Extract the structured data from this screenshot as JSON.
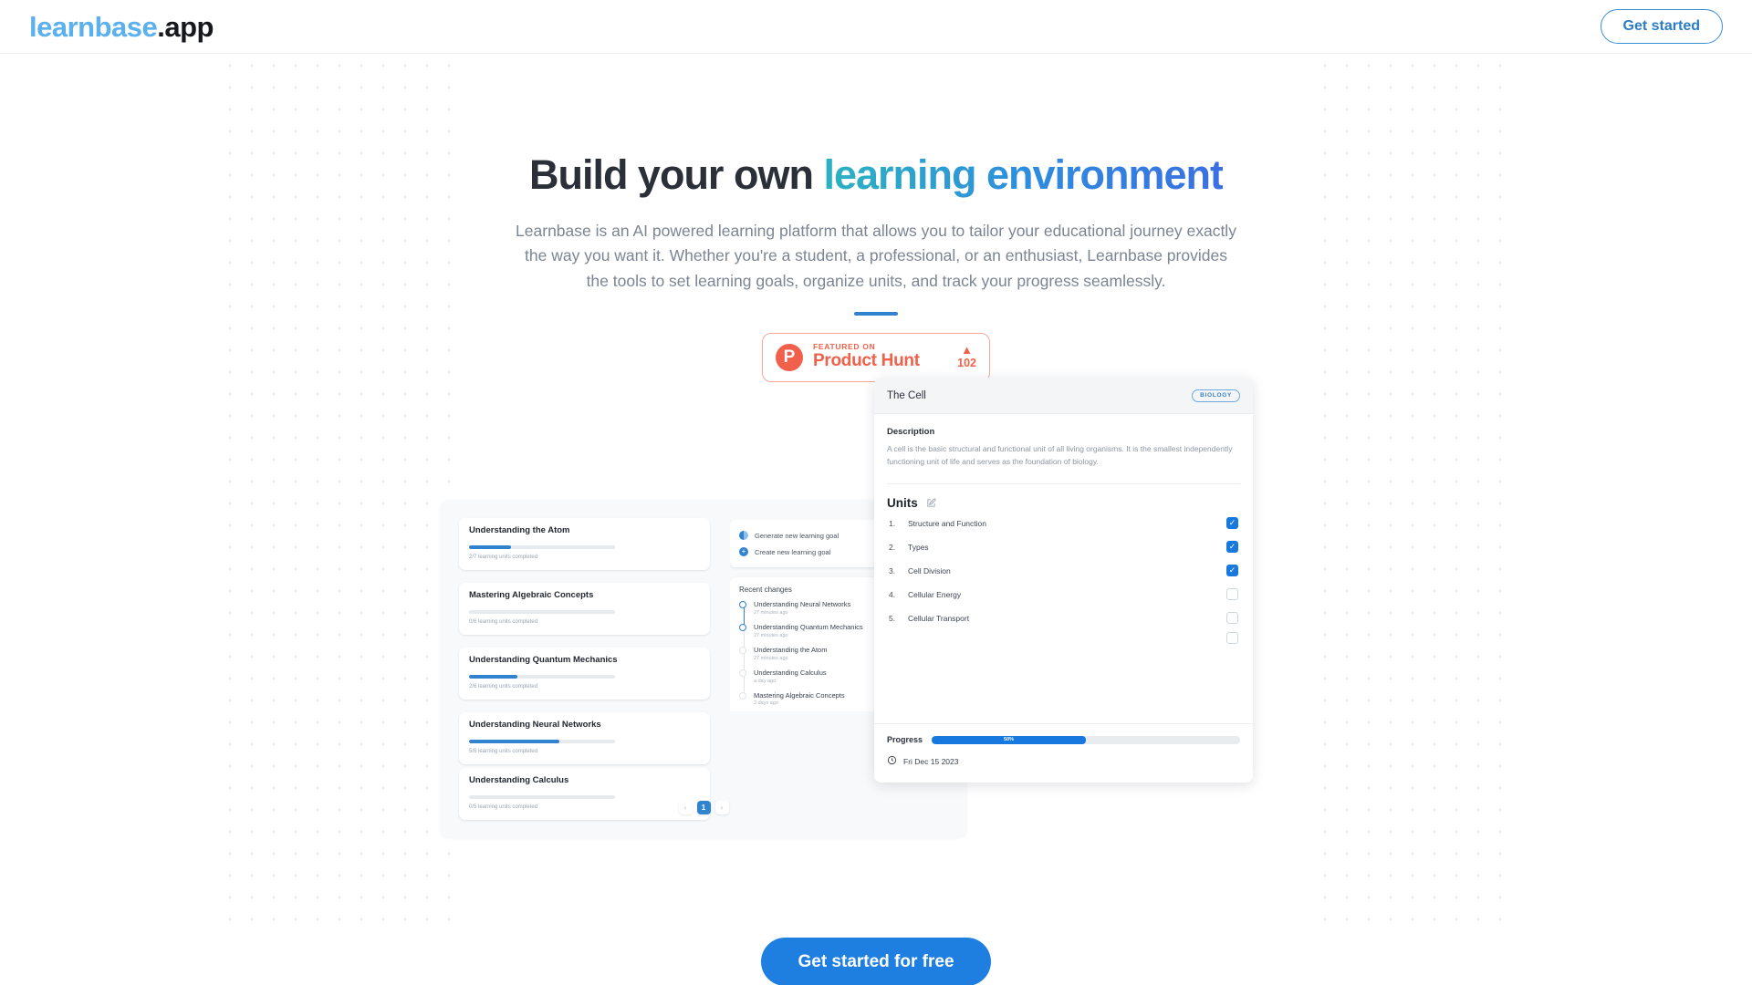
{
  "header": {
    "logo_brand": "learnbase",
    "logo_tld": ".app",
    "cta_label": "Get started"
  },
  "hero": {
    "headline_plain": "Build your own ",
    "headline_accent": "learning environment",
    "subtitle": "Learnbase is an AI powered learning platform that allows you to tailor your educational journey exactly the way you want it. Whether you're a student, a professional, or an enthusiast, Learnbase provides the tools to set learning goals, organize units, and track your progress seamlessly.",
    "product_hunt": {
      "logo_letter": "P",
      "kicker": "FEATURED ON",
      "name": "Product Hunt",
      "caret": "▲",
      "count": "102"
    }
  },
  "mockup": {
    "goals_panel": {
      "cards": [
        {
          "title": "Understanding the Atom",
          "progress_pct": 29,
          "sub": "2/7 learning units completed"
        },
        {
          "title": "Mastering Algebraic Concepts",
          "progress_pct": 0,
          "sub": "0/6 learning units completed"
        },
        {
          "title": "Understanding Quantum Mechanics",
          "progress_pct": 33,
          "sub": "2/6 learning units completed"
        },
        {
          "title": "Understanding Neural Networks",
          "progress_pct": 62,
          "sub": "5/8 learning units completed"
        },
        {
          "title": "Understanding Calculus",
          "progress_pct": 0,
          "sub": "0/5 learning units completed"
        }
      ],
      "pagination": {
        "prev": "‹",
        "current": "1",
        "next": "›"
      }
    },
    "actions_panel": {
      "actions": [
        {
          "label": "Generate new learning goal",
          "icon": "sparkle-icon"
        },
        {
          "label": "Create new learning goal",
          "icon": "plus-icon"
        }
      ],
      "recent_title": "Recent changes",
      "recent": [
        {
          "name": "Understanding Neural Networks",
          "time": "27 minutes ago",
          "active": true
        },
        {
          "name": "Understanding Quantum Mechanics",
          "time": "27 minutes ago",
          "active": true
        },
        {
          "name": "Understanding the Atom",
          "time": "27 minutes ago",
          "active": false
        },
        {
          "name": "Understanding Calculus",
          "time": "a day ago",
          "active": false
        },
        {
          "name": "Mastering Algebraic Concepts",
          "time": "3 days ago",
          "active": false
        }
      ]
    },
    "detail_panel": {
      "title": "The Cell",
      "badge": "BIOLOGY",
      "description_label": "Description",
      "description": "A cell is the basic structural and functional unit of all living organisms. It is the smallest independently functioning unit of life and serves as the foundation of biology.",
      "units_label": "Units",
      "units": [
        {
          "num": "1.",
          "name": "Structure and Function",
          "checked": true
        },
        {
          "num": "2.",
          "name": "Types",
          "checked": true
        },
        {
          "num": "3.",
          "name": "Cell Division",
          "checked": true
        },
        {
          "num": "4.",
          "name": "Cellular Energy",
          "checked": false
        },
        {
          "num": "5.",
          "name": "Cellular Transport",
          "checked": false
        }
      ],
      "progress_label": "Progress",
      "progress_pct": 50,
      "progress_text": "50%",
      "date": "Fri Dec 15 2023"
    }
  },
  "footer_cta": {
    "label": "Get started for free"
  },
  "colors": {
    "brand_blue": "#5bb0ee",
    "accent_blue": "#1e7fe0",
    "product_hunt_red": "#f1604a",
    "text_dark": "#2b2f38",
    "text_muted": "#7c8593"
  }
}
